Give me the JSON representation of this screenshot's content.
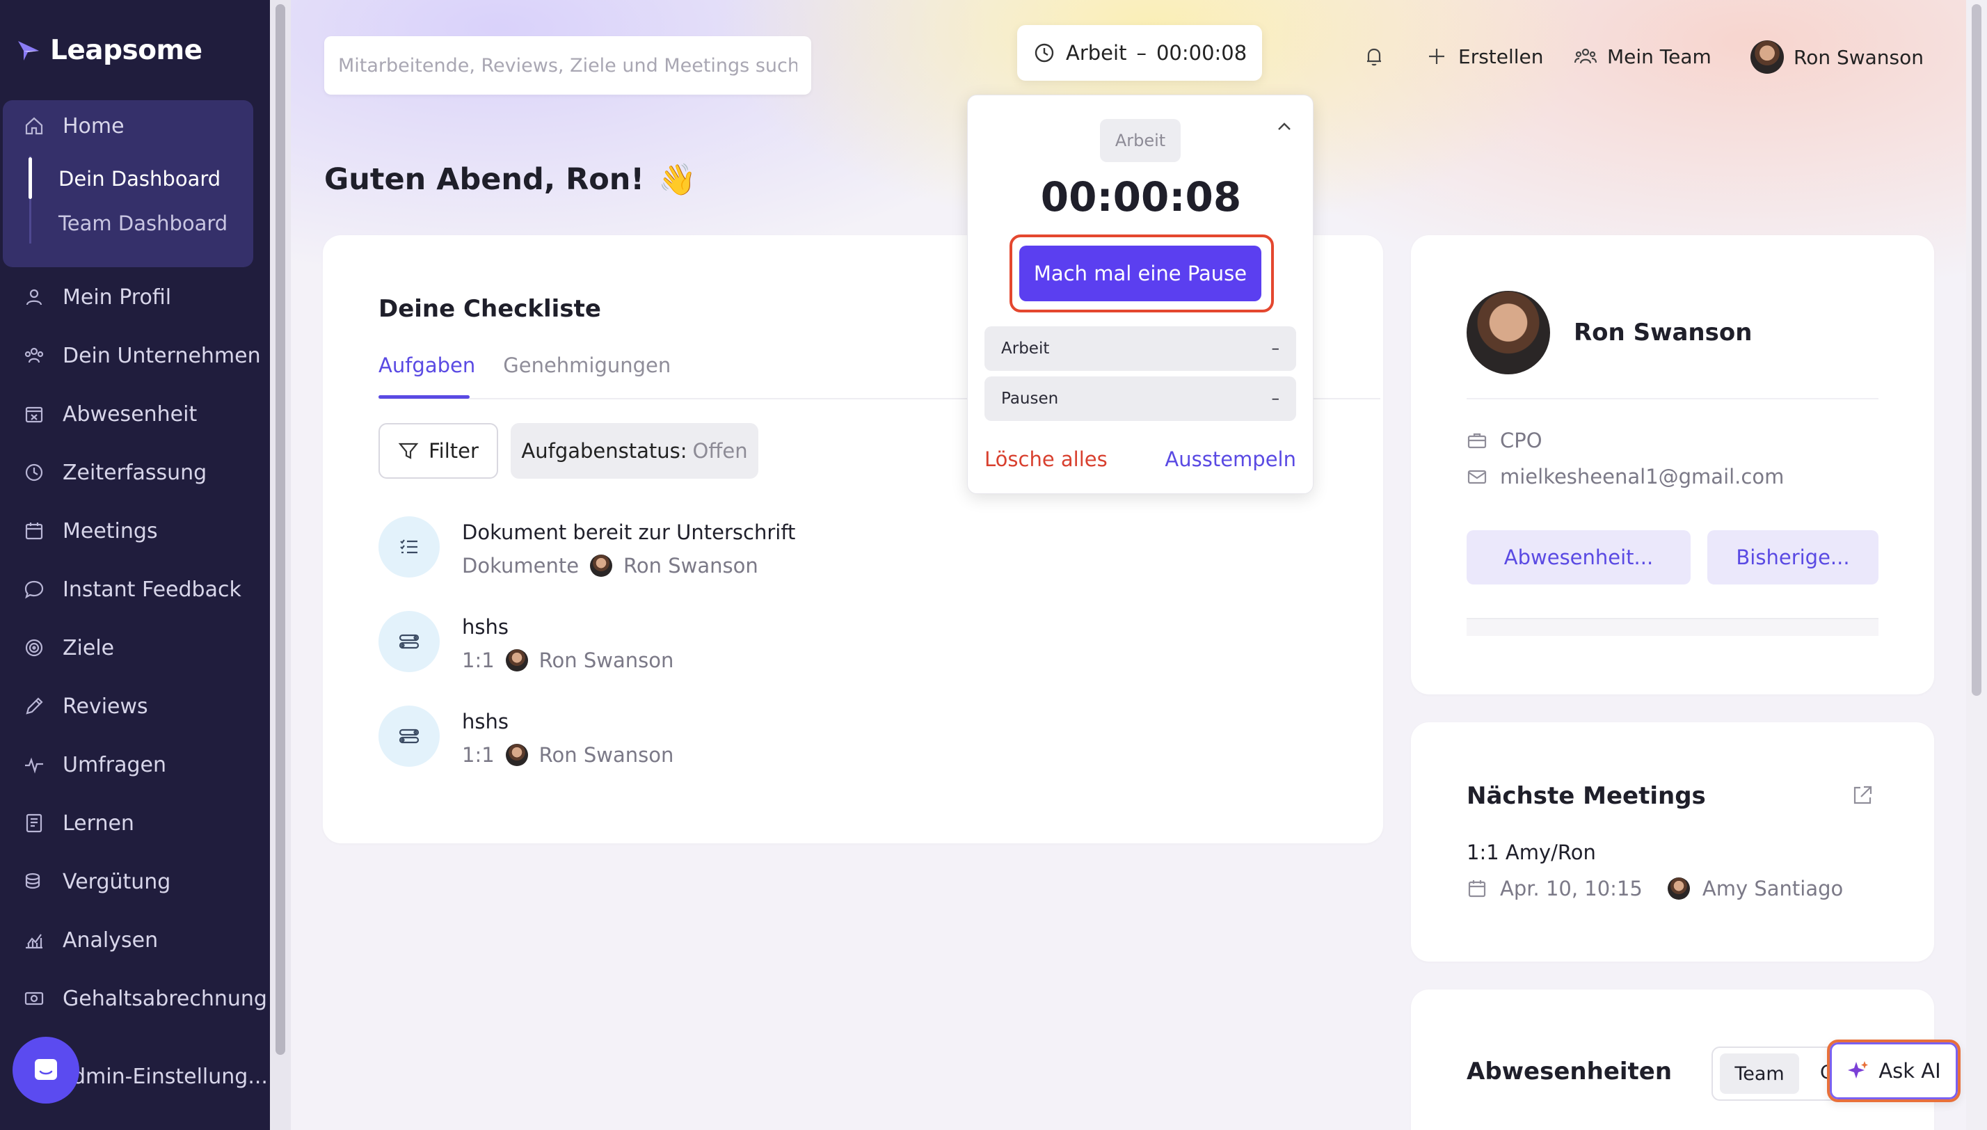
{
  "app": {
    "brand": "Leapsome",
    "accent": "#5a4ae3",
    "sidebar_bg": "#201d3d"
  },
  "sidebar": {
    "home": {
      "label": "Home",
      "icon": "home-icon"
    },
    "sub_items": [
      {
        "label": "Dein Dashboard",
        "active": true
      },
      {
        "label": "Team Dashboard",
        "active": false
      }
    ],
    "items": [
      {
        "label": "Mein Profil",
        "icon": "user-icon"
      },
      {
        "label": "Dein Unternehmen",
        "icon": "users-icon"
      },
      {
        "label": "Abwesenheit",
        "icon": "calendar-x-icon"
      },
      {
        "label": "Zeiterfassung",
        "icon": "clock-icon"
      },
      {
        "label": "Meetings",
        "icon": "calendar-icon"
      },
      {
        "label": "Instant Feedback",
        "icon": "chat-icon"
      },
      {
        "label": "Ziele",
        "icon": "target-icon"
      },
      {
        "label": "Reviews",
        "icon": "pencil-icon"
      },
      {
        "label": "Umfragen",
        "icon": "pulse-icon"
      },
      {
        "label": "Lernen",
        "icon": "book-icon"
      },
      {
        "label": "Vergütung",
        "icon": "coins-icon"
      },
      {
        "label": "Analysen",
        "icon": "chart-icon"
      },
      {
        "label": "Gehaltsabrechnung",
        "icon": "money-icon"
      },
      {
        "label": "dmin-Einstellung...",
        "icon": "settings-icon"
      }
    ]
  },
  "header": {
    "search_placeholder": "Mitarbeitende, Reviews, Ziele und Meetings suchen",
    "timer": {
      "label": "Arbeit",
      "separator": "–",
      "time": "00:00:08"
    },
    "create_label": "Erstellen",
    "team_label": "Mein Team",
    "user_name": "Ron Swanson"
  },
  "greeting": {
    "text": "Guten Abend, Ron!",
    "emoji": "👋"
  },
  "checklist": {
    "title": "Deine Checkliste",
    "tabs": [
      {
        "label": "Aufgaben",
        "active": true
      },
      {
        "label": "Genehmigungen",
        "active": false
      }
    ],
    "filter_label": "Filter",
    "status_label": "Aufgabenstatus:",
    "status_value": "Offen",
    "tasks": [
      {
        "title": "Dokument bereit zur Unterschrift",
        "category": "Dokumente",
        "person": "Ron Swanson",
        "icon": "checklist-icon"
      },
      {
        "title": "hshs",
        "category": "1:1",
        "person": "Ron Swanson",
        "icon": "one-on-one-icon"
      },
      {
        "title": "hshs",
        "category": "1:1",
        "person": "Ron Swanson",
        "icon": "one-on-one-icon"
      }
    ]
  },
  "timer_dropdown": {
    "chip": "Arbeit",
    "time": "00:00:08",
    "pause_button": "Mach mal eine Pause",
    "rows": [
      {
        "label": "Arbeit",
        "value": "–"
      },
      {
        "label": "Pausen",
        "value": "–"
      }
    ],
    "clear_label": "Lösche alles",
    "clock_out_label": "Ausstempeln"
  },
  "profile": {
    "name": "Ron Swanson",
    "role": "CPO",
    "email": "mielkesheenal1@gmail.com",
    "buttons": [
      "Abwesenheit...",
      "Bisherige..."
    ]
  },
  "meetings": {
    "title": "Nächste Meetings",
    "name": "1:1 Amy/Ron",
    "date": "Apr. 10, 10:15",
    "person": "Amy Santiago"
  },
  "absences": {
    "title": "Abwesenheiten",
    "segment_active": "Team",
    "segment_other": "C"
  },
  "ask_ai_label": "Ask AI"
}
